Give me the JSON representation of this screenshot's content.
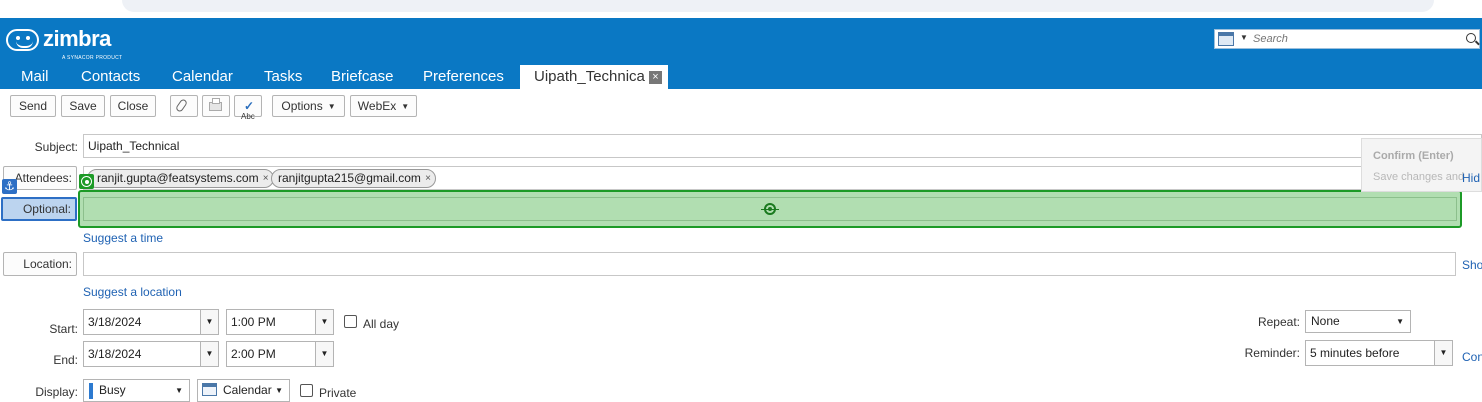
{
  "header": {
    "logo": {
      "wordmark": "zimbra",
      "tagline": "A SYNACOR PRODUCT"
    },
    "search": {
      "placeholder": "Search"
    },
    "tabs": [
      {
        "label": "Mail"
      },
      {
        "label": "Contacts"
      },
      {
        "label": "Calendar"
      },
      {
        "label": "Tasks"
      },
      {
        "label": "Briefcase"
      },
      {
        "label": "Preferences"
      },
      {
        "label": "Uipath_Technica",
        "active": true
      }
    ]
  },
  "toolbar": {
    "send_label": "Send",
    "save_label": "Save",
    "close_label": "Close",
    "options_label": "Options",
    "webex_label": "WebEx"
  },
  "form": {
    "subject_label": "Subject:",
    "subject_value": "Uipath_Technical",
    "attendees_label": "Attendees:",
    "attendees": [
      {
        "email": "ranjit.gupta@featsystems.com"
      },
      {
        "email": "ranjitgupta215@gmail.com"
      }
    ],
    "optional_label": "Optional:",
    "suggest_time": "Suggest a time",
    "location_label": "Location:",
    "show_link": "Sho",
    "suggest_location": "Suggest a location",
    "start_label": "Start:",
    "start_date": "3/18/2024",
    "start_time": "1:00 PM",
    "all_day_label": "All day",
    "end_label": "End:",
    "end_date": "3/18/2024",
    "end_time": "2:00 PM",
    "repeat_label": "Repeat:",
    "repeat_value": "None",
    "reminder_label": "Reminder:",
    "reminder_value": "5 minutes before",
    "reminder_link": "Con",
    "display_label": "Display:",
    "display_value": "Busy",
    "calendar_value": "Calendar",
    "private_label": "Private"
  },
  "popup": {
    "confirm_label": "Confirm (Enter)",
    "save_changes": "Save changes and",
    "hide_link": "Hid"
  },
  "colors": {
    "header_blue": "#0a78c4",
    "highlight_green": "#1c9a26",
    "selected_blue": "#2d6fc5",
    "link_blue": "#1f62b3"
  }
}
